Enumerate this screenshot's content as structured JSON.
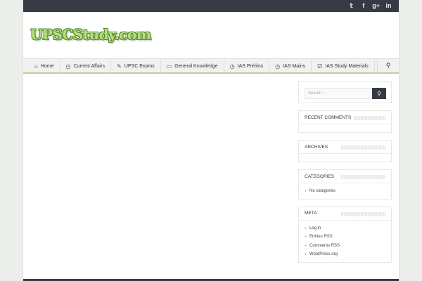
{
  "social": [
    {
      "label": "𝕥",
      "name": "twitter-icon"
    },
    {
      "label": "f",
      "name": "facebook-icon"
    },
    {
      "label": "g+",
      "name": "google-plus-icon"
    },
    {
      "label": "in",
      "name": "linkedin-icon"
    }
  ],
  "header": {
    "logo_text": "UPSCStudy.com"
  },
  "nav": {
    "items": [
      {
        "icon": "⌂",
        "label": "Home"
      },
      {
        "icon": "◷",
        "label": "Current Affairs"
      },
      {
        "icon": "✎",
        "label": "UPSC Exams"
      },
      {
        "icon": "▭",
        "label": "General Knowledge"
      },
      {
        "icon": "◷",
        "label": "IAS Prelims"
      },
      {
        "icon": "◷",
        "label": "IAS Mains"
      },
      {
        "icon": "☑",
        "label": "IAS Study Materials"
      }
    ],
    "search_icon": "⚲"
  },
  "sidebar": {
    "search": {
      "placeholder": "Search ...",
      "button_icon": "⚲"
    },
    "widgets": [
      {
        "title": "Recent Comments",
        "items": []
      },
      {
        "title": "Archives",
        "items": []
      },
      {
        "title": "Categories",
        "items": [
          "No categories"
        ]
      },
      {
        "title": "Meta",
        "items": [
          "Log in",
          "Entries RSS",
          "Comments RSS",
          "WordPress.org"
        ]
      }
    ]
  }
}
